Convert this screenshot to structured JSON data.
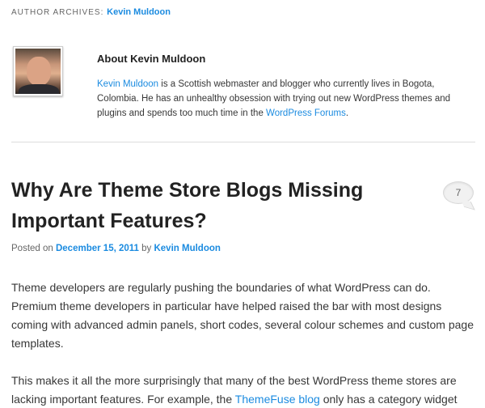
{
  "archive": {
    "label": "Author Archives:",
    "author": "Kevin Muldoon"
  },
  "author_box": {
    "title": "About Kevin Muldoon",
    "bio_link_name": "Kevin Muldoon",
    "bio_text_1": " is a Scottish webmaster and blogger who currently lives in Bogota, Colombia. He has an unhealthy obsession with trying out new WordPress themes and plugins and spends too much time in the ",
    "bio_link_forums": "WordPress Forums",
    "bio_text_2": "."
  },
  "post": {
    "title": "Why Are Theme Store Blogs Missing Important Features?",
    "comment_count": "7",
    "posted_on_label": "Posted on ",
    "date": "December 15, 2011",
    "by_label": " by ",
    "author": "Kevin Muldoon",
    "paragraph_1": "Theme developers are regularly pushing the boundaries of what WordPress can do. Premium theme developers in particular have helped raised the bar with most designs coming with advanced admin panels, short codes, several colour schemes and custom page templates.",
    "paragraph_2_a": "This makes it all the more surprisingly that many of the best WordPress theme stores are lacking important features. For example, the ",
    "paragraph_2_link": "ThemeFuse blog",
    "paragraph_2_b": " only has a category widget"
  }
}
